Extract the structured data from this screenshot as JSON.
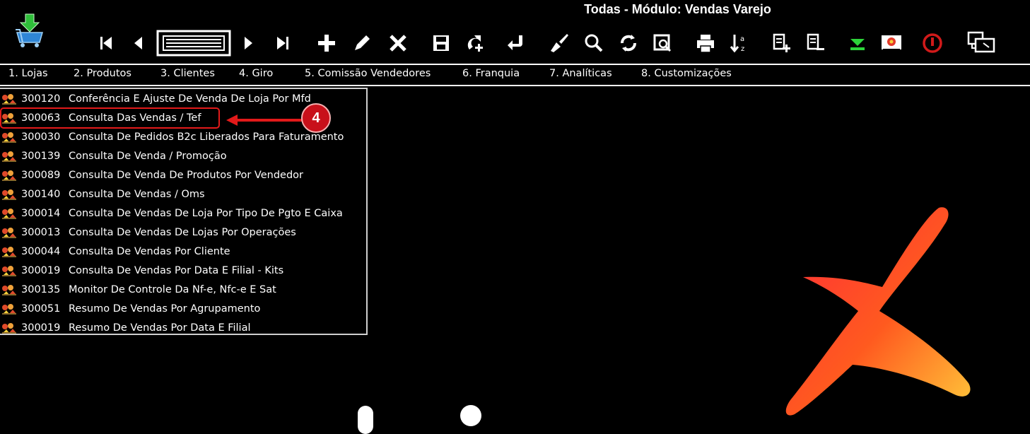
{
  "window": {
    "title": "Todas - Módulo: Vendas Varejo"
  },
  "toolbar": {
    "icons": [
      "cart-download-icon",
      "first-record-icon",
      "previous-record-icon",
      "list-view-icon",
      "next-record-icon",
      "last-record-icon",
      "add-icon",
      "edit-icon",
      "delete-icon",
      "save-icon",
      "duplicate-icon",
      "confirm-icon",
      "clear-icon",
      "search-icon",
      "refresh-icon",
      "preview-icon",
      "print-icon",
      "sort-az-icon",
      "document-add-icon",
      "document-remove-icon",
      "download-green-icon",
      "image-flower-icon",
      "power-icon",
      "screens-icon"
    ]
  },
  "menu": [
    {
      "label": "1. Lojas"
    },
    {
      "label": "2. Produtos"
    },
    {
      "label": "3. Clientes"
    },
    {
      "label": "4. Giro"
    },
    {
      "label": "5. Comissão Vendedores"
    },
    {
      "label": "6. Franquia"
    },
    {
      "label": "7. Analíticas"
    },
    {
      "label": "8. Customizações"
    }
  ],
  "programs": [
    {
      "code": "300120",
      "name": "Conferência E Ajuste De Venda De Loja Por Mfd"
    },
    {
      "code": "300063",
      "name": "Consulta Das Vendas / Tef"
    },
    {
      "code": "300030",
      "name": "Consulta De Pedidos B2c Liberados Para Faturamento"
    },
    {
      "code": "300139",
      "name": "Consulta De Venda / Promoção"
    },
    {
      "code": "300089",
      "name": "Consulta De Venda De Produtos Por Vendedor"
    },
    {
      "code": "300140",
      "name": "Consulta De Vendas / Oms"
    },
    {
      "code": "300014",
      "name": "Consulta De Vendas De Loja Por Tipo De Pgto E Caixa"
    },
    {
      "code": "300013",
      "name": "Consulta De Vendas De Lojas Por Operações"
    },
    {
      "code": "300044",
      "name": "Consulta De Vendas Por Cliente"
    },
    {
      "code": "300019",
      "name": "Consulta De Vendas Por Data E Filial - Kits"
    },
    {
      "code": "300135",
      "name": "Monitor De Controle Da Nf-e, Nfc-e E Sat"
    },
    {
      "code": "300051",
      "name": "Resumo De Vendas Por Agrupamento"
    },
    {
      "code": "300019",
      "name": "Resumo De Vendas Por Data E Filial"
    }
  ],
  "callout": {
    "number": "4",
    "color": "#c8101a"
  },
  "colors": {
    "background": "#000000",
    "text": "#ffffff",
    "highlight": "#e21a1a"
  }
}
